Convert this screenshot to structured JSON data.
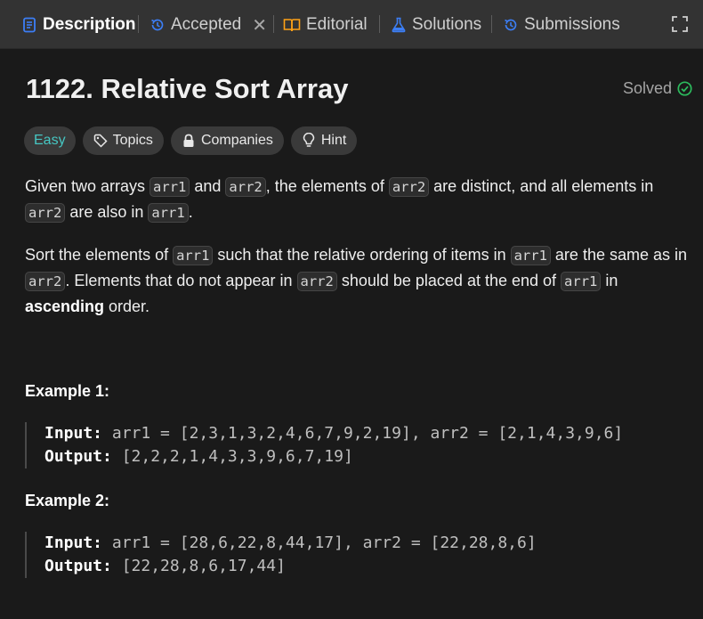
{
  "tabs": {
    "description": "Description",
    "accepted": "Accepted",
    "editorial": "Editorial",
    "solutions": "Solutions",
    "submissions": "Submissions"
  },
  "problem": {
    "title": "1122. Relative Sort Array",
    "status": "Solved"
  },
  "chips": {
    "difficulty": "Easy",
    "topics": "Topics",
    "companies": "Companies",
    "hint": "Hint"
  },
  "description": {
    "p1": {
      "t1": "Given two arrays ",
      "c1": "arr1",
      "t2": " and ",
      "c2": "arr2",
      "t3": ", the elements of ",
      "c3": "arr2",
      "t4": " are distinct, and all elements in ",
      "c4": "arr2",
      "t5": " are also in ",
      "c5": "arr1",
      "t6": "."
    },
    "p2": {
      "t1": "Sort the elements of ",
      "c1": "arr1",
      "t2": " such that the relative ordering of items in ",
      "c2": "arr1",
      "t3": " are the same as in ",
      "c3": "arr2",
      "t4": ". Elements that do not appear in ",
      "c4": "arr2",
      "t5": " should be placed at the end of ",
      "c5": "arr1",
      "t6": " in ",
      "b1": "ascending",
      "t7": " order."
    }
  },
  "examples": [
    {
      "title": "Example 1:",
      "input_label": "Input:",
      "input": " arr1 = [2,3,1,3,2,4,6,7,9,2,19], arr2 = [2,1,4,3,9,6]",
      "output_label": "Output:",
      "output": " [2,2,2,1,4,3,3,9,6,7,19]"
    },
    {
      "title": "Example 2:",
      "input_label": "Input:",
      "input": " arr1 = [28,6,22,8,44,17], arr2 = [22,28,8,6]",
      "output_label": "Output:",
      "output": " [22,28,8,6,17,44]"
    }
  ],
  "colors": {
    "background": "#1a1a1a",
    "tabbar": "#333333",
    "easy": "#46c6c2",
    "solved_check": "#2cbb5d",
    "accepted_icon": "#3c7ef5",
    "editorial_icon": "#ffa116",
    "solutions_icon": "#3c7ef5"
  }
}
